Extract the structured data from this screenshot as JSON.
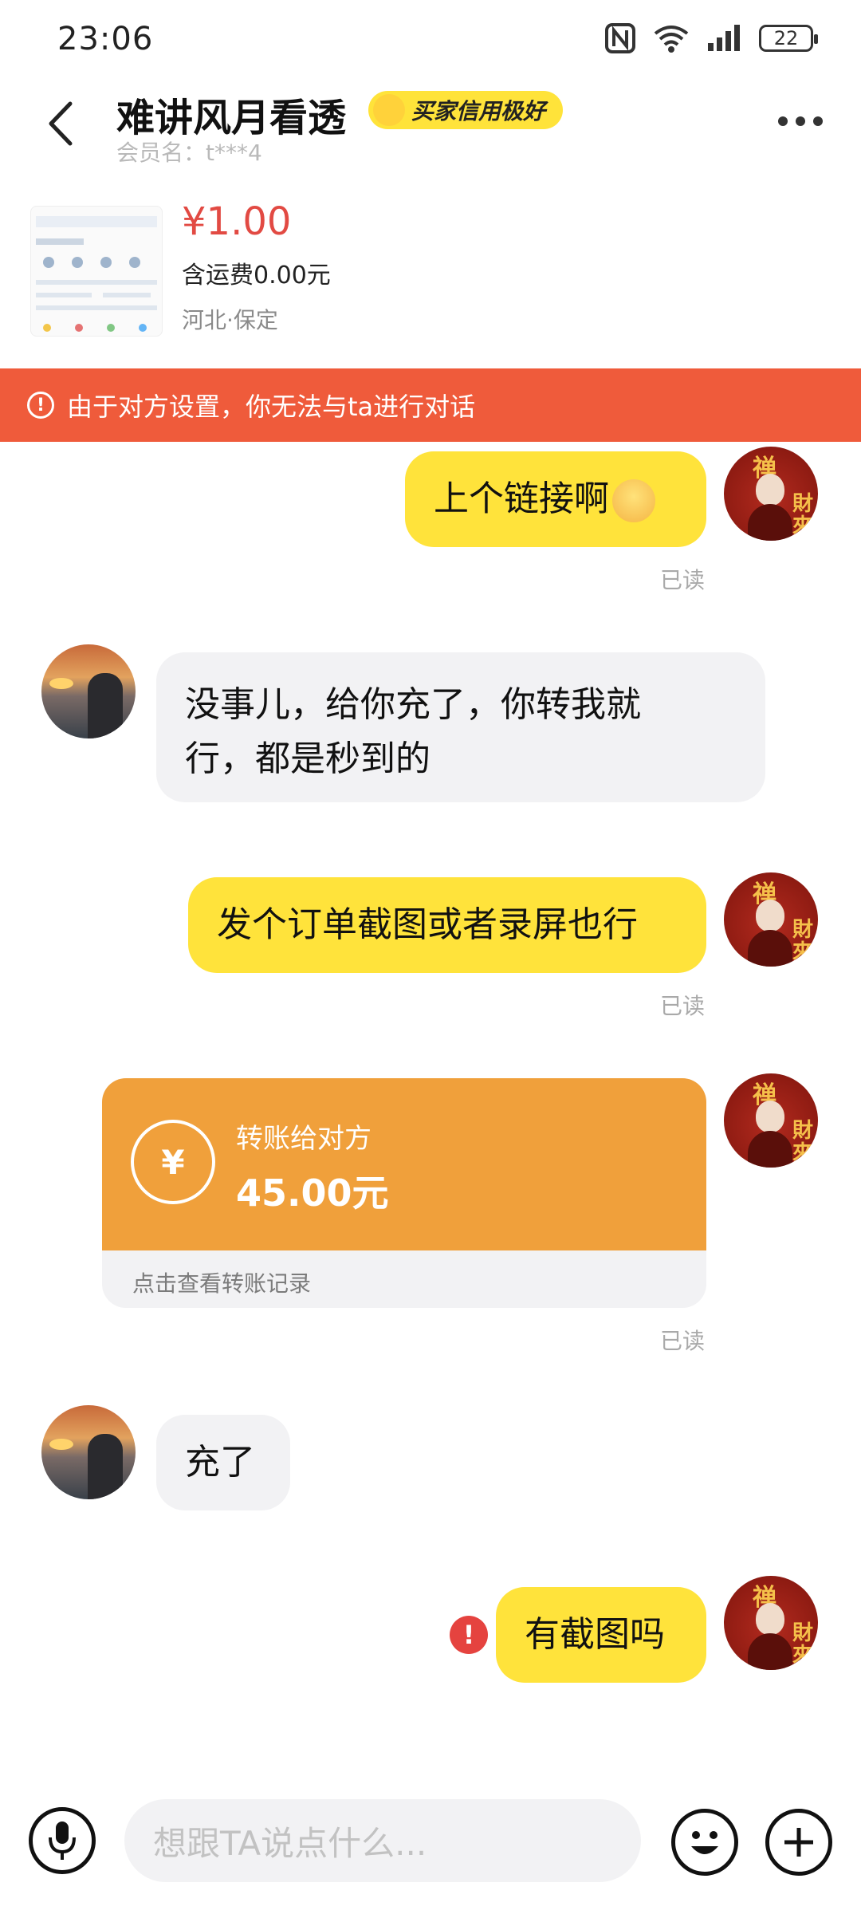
{
  "status_bar": {
    "time": "23:06",
    "battery": "22",
    "icons": [
      "nfc-icon",
      "wifi-icon",
      "signal-icon",
      "battery-icon"
    ]
  },
  "header": {
    "title": "难讲风月看透",
    "badge": "买家信用极好",
    "member_label": "会员名：t***4",
    "icons": [
      "back-arrow-icon",
      "more-icon"
    ]
  },
  "product": {
    "price": "¥1.00",
    "shipping": "含运费0.00元",
    "location": "河北·保定"
  },
  "warning": {
    "text": "由于对方设置，你无法与ta进行对话",
    "color": "#ef5b3b"
  },
  "messages": {
    "m1": {
      "text": "上个链接啊",
      "read": "已读"
    },
    "m2": {
      "line1": "没事儿，给你充了，你转我就",
      "line2": "行，都是秒到的"
    },
    "m3": {
      "text": "发个订单截图或者录屏也行",
      "read": "已读"
    },
    "m4": {
      "label": "转账给对方",
      "amount": "45.00元",
      "footer": "点击查看转账记录",
      "read": "已读"
    },
    "m5": {
      "text": "充了"
    },
    "m6": {
      "text": "有截图吗",
      "error_symbol": "!"
    }
  },
  "input": {
    "placeholder": "想跟TA说点什么..."
  },
  "colors": {
    "my_bubble": "#ffe33b",
    "their_bubble": "#f2f2f4",
    "transfer": "#f0a03b",
    "price": "#e24a43"
  }
}
